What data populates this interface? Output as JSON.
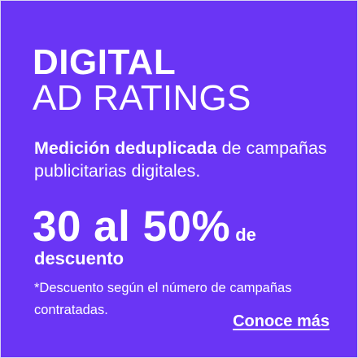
{
  "banner": {
    "title_line_1": "DIGITAL",
    "title_line_2": "AD RATINGS",
    "description_bold": "Medición deduplicada",
    "description_rest": " de campañas publicitarias digitales.",
    "discount_big": "30 al 50%",
    "discount_small": "de",
    "discount_word": "descuento",
    "footnote": "*Descuento según el número de campañas contratadas.",
    "cta_label": "Conoce más"
  },
  "colors": {
    "background": "#6a35f5",
    "text": "#ffffff"
  }
}
